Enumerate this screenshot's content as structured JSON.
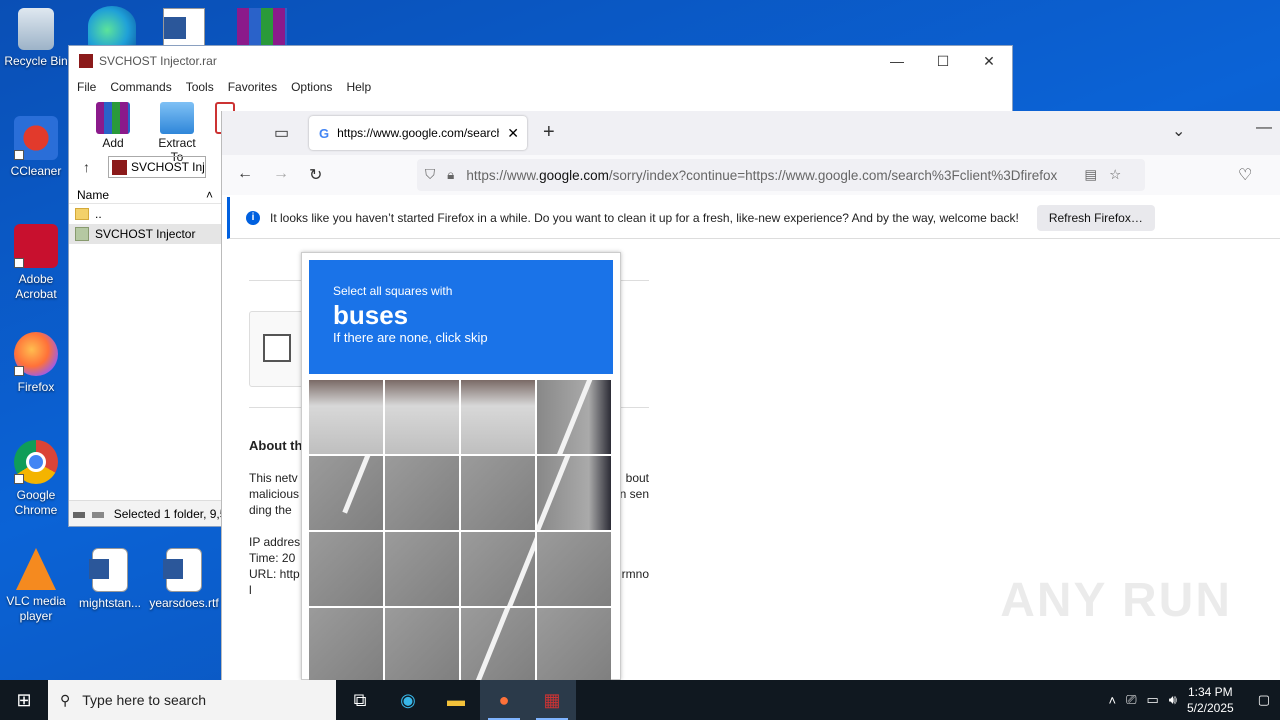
{
  "desktop": {
    "icons": [
      {
        "label": "Recycle Bin"
      },
      {
        "label": "CCleaner"
      },
      {
        "label": "Adobe Acrobat"
      },
      {
        "label": "Firefox"
      },
      {
        "label": "Google Chrome"
      },
      {
        "label": "VLC media player"
      },
      {
        "label": "mightstan..."
      },
      {
        "label": "yearsdoes.rtf"
      }
    ]
  },
  "winrar": {
    "title": "SVCHOST Injector.rar",
    "menu": [
      "File",
      "Commands",
      "Tools",
      "Favorites",
      "Options",
      "Help"
    ],
    "toolbar": [
      "Add",
      "Extract To",
      "T"
    ],
    "address": "SVCHOST Inje",
    "column_name": "Name",
    "rows": [
      {
        "name": ".."
      },
      {
        "name": "SVCHOST Injector"
      }
    ],
    "status": "Selected 1 folder, 9,5"
  },
  "firefox": {
    "tab_title": "https://www.google.com/search",
    "url_prefix": "https://www.",
    "url_domain": "google.com",
    "url_rest": "/sorry/index?continue=https://www.google.com/search%3Fclient%3Dfirefox",
    "notification": "It looks like you haven’t started Firefox in a while. Do you want to clean it up for a fresh, like-new experience? And by the way, welcome back!",
    "refresh_button": "Refresh Firefox…"
  },
  "sorry_page": {
    "about_title": "About th",
    "para1_lines": [
      "This netv",
      "malicious",
      "ding the"
    ],
    "para1_right": [
      "bout",
      "n sen",
      ""
    ],
    "ip_label": "IP addres",
    "time_label": "Time: 20",
    "url_label": "URL: http",
    "url_tail": "rmno",
    "last": "l"
  },
  "captcha": {
    "instruction": "Select all squares with",
    "target": "buses",
    "hint": "If there are none, click skip"
  },
  "watermark": "ANY RUN",
  "taskbar": {
    "search_placeholder": "Type here to search",
    "time": "1:34 PM",
    "date": "5/2/2025"
  }
}
